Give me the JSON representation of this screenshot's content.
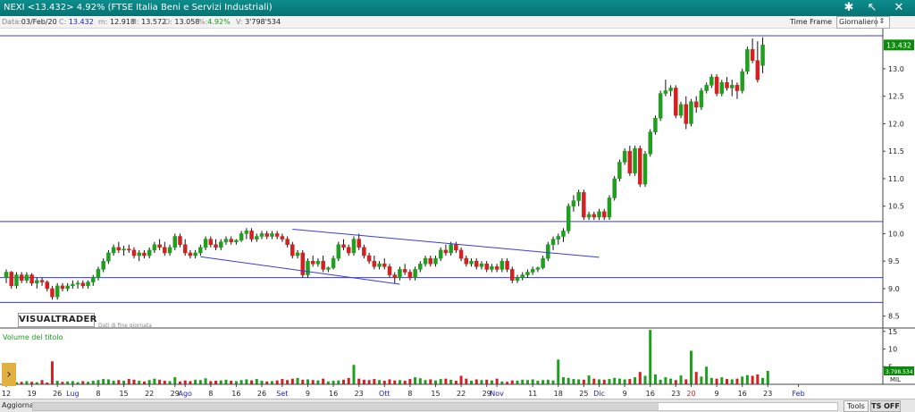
{
  "window": {
    "title": "NEXI <13.432> 4.92%  (FTSE Italia Beni e Servizi Industriali)",
    "icons": [
      "star-icon",
      "arrow-icon",
      "cross-icon"
    ]
  },
  "infobar": {
    "date_label": "Data:",
    "date_value": "03/Feb/20",
    "close_label": "C:",
    "close_value": "13.432",
    "min_label": "m:",
    "min_value": "12.918",
    "max_label": "M:",
    "max_value": "13.572",
    "open_label": "O:",
    "open_value": "13.058",
    "pct_label": "%:",
    "pct_value": "4.92%",
    "vol_label": "V:",
    "vol_value": "3'798'534"
  },
  "timeframe": {
    "label": "Time Frame",
    "selected": "Giornaliero"
  },
  "logo": {
    "text": "VISUALTRADER",
    "subtitle": "Dati di fine giornata"
  },
  "volume_panel": {
    "title": "Volume del titolo",
    "unit": "MIL",
    "last_value": "3.798.534"
  },
  "bottom": {
    "aggiorna": "Aggiorna",
    "tools": "Tools",
    "tsoff": "TS OFF"
  },
  "colors": {
    "up": "#1ea01e",
    "down": "#d42020",
    "trendline": "#3a3ae0",
    "hline": "#3a3ad0",
    "last_price_bg": "#0b8a0b",
    "volume_up": "#1ea01e",
    "volume_down": "#d42020"
  },
  "chart_data": [
    {
      "type": "candlestick",
      "title": "",
      "x_tick_labels": [
        {
          "i": 0,
          "t": "12"
        },
        {
          "i": 5,
          "t": "19"
        },
        {
          "i": 10,
          "t": "26"
        },
        {
          "i": 13,
          "t": "Lug",
          "month": true
        },
        {
          "i": 18,
          "t": "8"
        },
        {
          "i": 23,
          "t": "15"
        },
        {
          "i": 28,
          "t": "22"
        },
        {
          "i": 33,
          "t": "29"
        },
        {
          "i": 35,
          "t": "Ago",
          "month": true
        },
        {
          "i": 40,
          "t": "8"
        },
        {
          "i": 45,
          "t": "16"
        },
        {
          "i": 50,
          "t": "26"
        },
        {
          "i": 54,
          "t": "Set",
          "month": true
        },
        {
          "i": 59,
          "t": "9"
        },
        {
          "i": 64,
          "t": "16"
        },
        {
          "i": 69,
          "t": "23"
        },
        {
          "i": 74,
          "t": "Ott",
          "month": true
        },
        {
          "i": 79,
          "t": "8"
        },
        {
          "i": 84,
          "t": "15"
        },
        {
          "i": 89,
          "t": "22"
        },
        {
          "i": 94,
          "t": "29"
        },
        {
          "i": 96,
          "t": "Nov",
          "month": true
        },
        {
          "i": 103,
          "t": "11"
        },
        {
          "i": 108,
          "t": "18"
        },
        {
          "i": 113,
          "t": "25"
        },
        {
          "i": 116,
          "t": "Dic",
          "month": true
        },
        {
          "i": 121,
          "t": "9"
        },
        {
          "i": 126,
          "t": "16"
        },
        {
          "i": 131,
          "t": "23"
        },
        {
          "i": 134,
          "t": "20",
          "month": true
        },
        {
          "i": 139,
          "t": "9"
        },
        {
          "i": 144,
          "t": "16"
        },
        {
          "i": 149,
          "t": "23"
        },
        {
          "i": 155,
          "t": "Feb",
          "month": true
        }
      ],
      "y_ticks": [
        8.5,
        9.0,
        9.5,
        10.0,
        10.5,
        11.0,
        11.5,
        12.0,
        12.5,
        13.0
      ],
      "ylim": [
        8.3,
        13.6
      ],
      "last_price_label": "13.432",
      "horizontal_lines": [
        13.6,
        10.22,
        9.2,
        8.75
      ],
      "trendlines": [
        {
          "i1": 56,
          "v1": 10.08,
          "i2": 116,
          "v2": 9.57
        },
        {
          "i1": 38,
          "v1": 9.58,
          "i2": 77,
          "v2": 9.08
        }
      ],
      "candles": [
        [
          9.2,
          9.35,
          9.1,
          9.3
        ],
        [
          9.3,
          9.32,
          9.0,
          9.05
        ],
        [
          9.05,
          9.3,
          9.0,
          9.25
        ],
        [
          9.25,
          9.3,
          9.1,
          9.15
        ],
        [
          9.15,
          9.3,
          9.1,
          9.25
        ],
        [
          9.25,
          9.28,
          9.05,
          9.1
        ],
        [
          9.1,
          9.2,
          9.0,
          9.15
        ],
        [
          9.15,
          9.2,
          9.05,
          9.12
        ],
        [
          9.12,
          9.15,
          8.95,
          9.0
        ],
        [
          9.0,
          9.05,
          8.8,
          8.85
        ],
        [
          8.85,
          9.1,
          8.8,
          9.05
        ],
        [
          9.05,
          9.1,
          8.95,
          9.0
        ],
        [
          9.0,
          9.1,
          8.95,
          9.05
        ],
        [
          9.05,
          9.15,
          9.0,
          9.08
        ],
        [
          9.08,
          9.15,
          9.0,
          9.1
        ],
        [
          9.1,
          9.15,
          9.0,
          9.05
        ],
        [
          9.05,
          9.15,
          9.0,
          9.12
        ],
        [
          9.12,
          9.25,
          9.05,
          9.2
        ],
        [
          9.2,
          9.4,
          9.15,
          9.35
        ],
        [
          9.35,
          9.55,
          9.3,
          9.5
        ],
        [
          9.5,
          9.7,
          9.45,
          9.65
        ],
        [
          9.65,
          9.8,
          9.6,
          9.75
        ],
        [
          9.75,
          9.85,
          9.65,
          9.7
        ],
        [
          9.7,
          9.78,
          9.6,
          9.72
        ],
        [
          9.72,
          9.8,
          9.65,
          9.7
        ],
        [
          9.7,
          9.75,
          9.55,
          9.6
        ],
        [
          9.6,
          9.7,
          9.5,
          9.65
        ],
        [
          9.65,
          9.7,
          9.55,
          9.6
        ],
        [
          9.6,
          9.75,
          9.55,
          9.7
        ],
        [
          9.7,
          9.85,
          9.65,
          9.8
        ],
        [
          9.8,
          9.9,
          9.7,
          9.75
        ],
        [
          9.75,
          9.85,
          9.6,
          9.65
        ],
        [
          9.65,
          9.8,
          9.6,
          9.75
        ],
        [
          9.75,
          10.0,
          9.7,
          9.95
        ],
        [
          9.95,
          10.0,
          9.75,
          9.8
        ],
        [
          9.8,
          9.9,
          9.6,
          9.65
        ],
        [
          9.65,
          9.7,
          9.55,
          9.6
        ],
        [
          9.6,
          9.7,
          9.55,
          9.65
        ],
        [
          9.65,
          9.8,
          9.6,
          9.75
        ],
        [
          9.75,
          9.95,
          9.7,
          9.9
        ],
        [
          9.9,
          9.95,
          9.75,
          9.8
        ],
        [
          9.8,
          9.9,
          9.7,
          9.75
        ],
        [
          9.75,
          9.9,
          9.7,
          9.85
        ],
        [
          9.85,
          9.95,
          9.8,
          9.9
        ],
        [
          9.9,
          9.95,
          9.8,
          9.85
        ],
        [
          9.85,
          9.9,
          9.8,
          9.88
        ],
        [
          9.88,
          10.05,
          9.85,
          10.0
        ],
        [
          10.0,
          10.1,
          9.9,
          10.05
        ],
        [
          10.05,
          10.1,
          9.85,
          9.9
        ],
        [
          9.9,
          10.0,
          9.85,
          9.95
        ],
        [
          9.95,
          10.05,
          9.9,
          10.0
        ],
        [
          10.0,
          10.05,
          9.9,
          9.95
        ],
        [
          9.95,
          10.05,
          9.9,
          10.0
        ],
        [
          10.0,
          10.05,
          9.9,
          9.95
        ],
        [
          9.95,
          10.0,
          9.85,
          9.9
        ],
        [
          9.9,
          9.95,
          9.75,
          9.8
        ],
        [
          9.8,
          9.85,
          9.55,
          9.6
        ],
        [
          9.6,
          9.7,
          9.55,
          9.65
        ],
        [
          9.65,
          9.7,
          9.2,
          9.25
        ],
        [
          9.25,
          9.55,
          9.2,
          9.5
        ],
        [
          9.5,
          9.6,
          9.4,
          9.45
        ],
        [
          9.45,
          9.55,
          9.4,
          9.5
        ],
        [
          9.5,
          9.6,
          9.3,
          9.35
        ],
        [
          9.35,
          9.4,
          9.3,
          9.38
        ],
        [
          9.38,
          9.6,
          9.35,
          9.55
        ],
        [
          9.55,
          9.85,
          9.5,
          9.8
        ],
        [
          9.8,
          9.9,
          9.7,
          9.75
        ],
        [
          9.75,
          9.8,
          9.6,
          9.65
        ],
        [
          9.65,
          9.95,
          9.6,
          9.9
        ],
        [
          9.9,
          10.0,
          9.7,
          9.75
        ],
        [
          9.75,
          9.8,
          9.55,
          9.6
        ],
        [
          9.6,
          9.65,
          9.45,
          9.5
        ],
        [
          9.5,
          9.6,
          9.35,
          9.4
        ],
        [
          9.4,
          9.5,
          9.35,
          9.45
        ],
        [
          9.45,
          9.55,
          9.35,
          9.4
        ],
        [
          9.4,
          9.45,
          9.2,
          9.25
        ],
        [
          9.25,
          9.3,
          9.1,
          9.2
        ],
        [
          9.2,
          9.4,
          9.15,
          9.35
        ],
        [
          9.35,
          9.45,
          9.25,
          9.3
        ],
        [
          9.3,
          9.35,
          9.15,
          9.2
        ],
        [
          9.2,
          9.4,
          9.15,
          9.35
        ],
        [
          9.35,
          9.5,
          9.3,
          9.45
        ],
        [
          9.45,
          9.6,
          9.4,
          9.55
        ],
        [
          9.55,
          9.6,
          9.4,
          9.45
        ],
        [
          9.45,
          9.6,
          9.4,
          9.55
        ],
        [
          9.55,
          9.75,
          9.5,
          9.7
        ],
        [
          9.7,
          9.8,
          9.6,
          9.65
        ],
        [
          9.65,
          9.85,
          9.6,
          9.8
        ],
        [
          9.8,
          9.85,
          9.65,
          9.7
        ],
        [
          9.7,
          9.75,
          9.5,
          9.55
        ],
        [
          9.55,
          9.6,
          9.4,
          9.45
        ],
        [
          9.45,
          9.55,
          9.4,
          9.5
        ],
        [
          9.5,
          9.55,
          9.35,
          9.4
        ],
        [
          9.4,
          9.5,
          9.35,
          9.45
        ],
        [
          9.45,
          9.5,
          9.3,
          9.35
        ],
        [
          9.35,
          9.45,
          9.3,
          9.4
        ],
        [
          9.4,
          9.45,
          9.3,
          9.35
        ],
        [
          9.35,
          9.55,
          9.3,
          9.5
        ],
        [
          9.5,
          9.55,
          9.3,
          9.35
        ],
        [
          9.35,
          9.4,
          9.1,
          9.15
        ],
        [
          9.15,
          9.25,
          9.1,
          9.2
        ],
        [
          9.2,
          9.3,
          9.15,
          9.25
        ],
        [
          9.25,
          9.35,
          9.2,
          9.3
        ],
        [
          9.3,
          9.4,
          9.25,
          9.35
        ],
        [
          9.35,
          9.4,
          9.3,
          9.38
        ],
        [
          9.38,
          9.6,
          9.35,
          9.55
        ],
        [
          9.55,
          9.85,
          9.5,
          9.8
        ],
        [
          9.8,
          9.95,
          9.7,
          9.9
        ],
        [
          9.9,
          10.0,
          9.8,
          9.95
        ],
        [
          9.95,
          10.1,
          9.85,
          10.05
        ],
        [
          10.05,
          10.55,
          10.0,
          10.5
        ],
        [
          10.5,
          10.7,
          10.4,
          10.6
        ],
        [
          10.6,
          10.8,
          10.5,
          10.75
        ],
        [
          10.75,
          10.8,
          10.25,
          10.3
        ],
        [
          10.3,
          10.4,
          10.25,
          10.35
        ],
        [
          10.35,
          10.4,
          10.25,
          10.3
        ],
        [
          10.3,
          10.45,
          10.25,
          10.4
        ],
        [
          10.4,
          10.45,
          10.25,
          10.3
        ],
        [
          10.3,
          10.7,
          10.25,
          10.65
        ],
        [
          10.65,
          11.05,
          10.6,
          11.0
        ],
        [
          11.0,
          11.35,
          10.95,
          11.3
        ],
        [
          11.3,
          11.55,
          11.25,
          11.5
        ],
        [
          11.5,
          11.6,
          11.05,
          11.1
        ],
        [
          11.1,
          11.6,
          11.05,
          11.55
        ],
        [
          11.55,
          11.6,
          10.85,
          10.9
        ],
        [
          10.9,
          11.5,
          10.85,
          11.45
        ],
        [
          11.45,
          11.9,
          11.4,
          11.85
        ],
        [
          11.85,
          12.15,
          11.8,
          12.1
        ],
        [
          12.1,
          12.6,
          12.05,
          12.55
        ],
        [
          12.55,
          12.8,
          12.5,
          12.6
        ],
        [
          12.6,
          12.7,
          12.5,
          12.65
        ],
        [
          12.65,
          12.7,
          12.1,
          12.15
        ],
        [
          12.15,
          12.4,
          12.1,
          12.35
        ],
        [
          12.35,
          12.5,
          11.9,
          12.0
        ],
        [
          12.0,
          12.45,
          11.95,
          12.4
        ],
        [
          12.4,
          12.5,
          12.2,
          12.3
        ],
        [
          12.3,
          12.65,
          12.25,
          12.6
        ],
        [
          12.6,
          12.75,
          12.55,
          12.7
        ],
        [
          12.7,
          12.9,
          12.65,
          12.85
        ],
        [
          12.85,
          12.9,
          12.5,
          12.55
        ],
        [
          12.55,
          12.8,
          12.5,
          12.75
        ],
        [
          12.75,
          12.85,
          12.6,
          12.65
        ],
        [
          12.65,
          12.8,
          12.5,
          12.7
        ],
        [
          12.7,
          12.75,
          12.45,
          12.6
        ],
        [
          12.6,
          13.0,
          12.55,
          12.95
        ],
        [
          12.95,
          13.4,
          12.9,
          13.35
        ],
        [
          13.35,
          13.55,
          13.1,
          13.15
        ],
        [
          13.15,
          13.5,
          12.75,
          12.8
        ],
        [
          13.058,
          13.572,
          12.918,
          13.432
        ]
      ],
      "volume_y_ticks": [
        5,
        10,
        15
      ],
      "volume_ylim": [
        0,
        15.7
      ],
      "volumes": [
        0.8,
        1.0,
        0.6,
        0.7,
        0.9,
        0.7,
        0.6,
        1.2,
        0.5,
        6.5,
        1.0,
        0.7,
        0.8,
        0.9,
        0.6,
        0.9,
        0.7,
        1.0,
        1.2,
        1.5,
        1.4,
        1.0,
        1.2,
        1.0,
        1.5,
        1.3,
        1.0,
        0.8,
        1.2,
        1.6,
        1.3,
        1.0,
        0.9,
        2.0,
        0.8,
        1.1,
        0.9,
        1.3,
        1.2,
        1.7,
        0.9,
        1.0,
        1.1,
        1.3,
        1.0,
        0.9,
        1.2,
        1.4,
        1.1,
        1.5,
        1.0,
        0.8,
        0.9,
        1.1,
        1.5,
        1.2,
        1.6,
        1.8,
        1.3,
        1.4,
        1.2,
        1.1,
        1.6,
        0.8,
        1.0,
        1.1,
        1.3,
        1.8,
        5.5,
        1.6,
        1.3,
        1.2,
        1.5,
        1.2,
        1.0,
        1.4,
        1.1,
        1.2,
        1.0,
        1.5,
        2.0,
        1.7,
        1.2,
        1.4,
        1.1,
        1.5,
        1.6,
        1.3,
        1.0,
        2.4,
        1.6,
        1.0,
        1.4,
        1.2,
        1.3,
        1.1,
        1.6,
        0.8,
        0.7,
        1.1,
        1.0,
        1.3,
        1.2,
        1.4,
        1.0,
        1.2,
        1.3,
        1.1,
        7.0,
        2.0,
        1.8,
        1.5,
        1.4,
        1.3,
        2.5,
        1.6,
        1.4,
        1.3,
        1.5,
        1.8,
        1.6,
        1.4,
        1.5,
        2.0,
        3.5,
        2.4,
        15.4,
        2.8,
        1.3,
        2.0,
        1.6,
        1.2,
        2.5,
        1.4,
        9.5,
        3.5,
        2.2,
        5.0,
        1.8,
        1.6,
        2.0,
        1.5,
        1.4,
        1.6,
        2.2,
        2.6,
        2.4,
        2.8,
        1.8,
        3.8
      ]
    }
  ]
}
